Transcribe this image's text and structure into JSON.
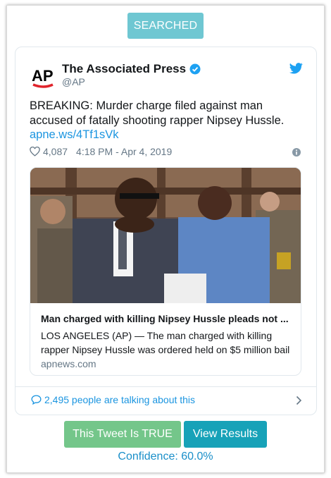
{
  "header": {
    "status_label": "SEARCHED"
  },
  "tweet": {
    "author_name": "The Associated Press",
    "handle": "@AP",
    "avatar_text": "AP",
    "text": "BREAKING: Murder charge filed against man accused of fatally shooting rapper Nipsey Hussle.",
    "link": "apne.ws/4Tf1sVk",
    "likes": "4,087",
    "timestamp": "4:18 PM - Apr 4, 2019",
    "card": {
      "title": "Man charged with killing Nipsey Hussle pleads not ...",
      "description": "LOS ANGELES (AP) — The man charged with killing rapper Nipsey Hussle was ordered held on $5 million bail",
      "domain": "apnews.com"
    },
    "talking": "2,495 people are talking about this"
  },
  "actions": {
    "true_label": "This Tweet Is TRUE",
    "results_label": "View Results",
    "confidence": "Confidence: 60.0%"
  },
  "colors": {
    "searched": "#6fc7d2",
    "true_button": "#74c68a",
    "results_button": "#17a2b8",
    "twitter_blue": "#1b95e0"
  },
  "icons": [
    "verified-icon",
    "twitter-bird-icon",
    "heart-icon",
    "info-icon",
    "speech-bubble-icon",
    "chevron-right-icon"
  ]
}
